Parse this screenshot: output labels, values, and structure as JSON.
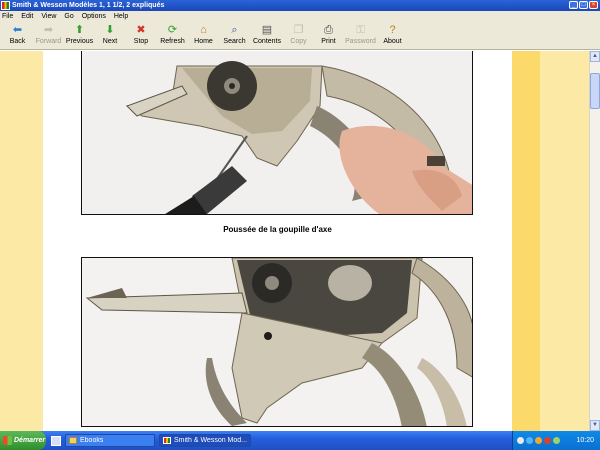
{
  "window": {
    "title": "Smith & Wesson Modèles 1, 1 1/2, 2 expliqués",
    "controls": [
      "_",
      "□",
      "×"
    ]
  },
  "menu": [
    "File",
    "Edit",
    "View",
    "Go",
    "Options",
    "Help"
  ],
  "toolbar": [
    {
      "label": "Back",
      "icon": "back-arrow-icon",
      "glyph": "⬅",
      "color": "#2a7fd4",
      "enabled": true
    },
    {
      "label": "Forward",
      "icon": "forward-arrow-icon",
      "glyph": "➡",
      "color": "#8a8a8a",
      "enabled": false
    },
    {
      "label": "Previous",
      "icon": "previous-arrow-icon",
      "glyph": "⬆",
      "color": "#2f9e2f",
      "enabled": true
    },
    {
      "label": "Next",
      "icon": "next-arrow-icon",
      "glyph": "⬇",
      "color": "#2f9e2f",
      "enabled": true
    },
    {
      "label": "Stop",
      "icon": "stop-icon",
      "glyph": "✖",
      "color": "#d3342a",
      "enabled": true
    },
    {
      "label": "Refresh",
      "icon": "refresh-icon",
      "glyph": "⟳",
      "color": "#2f9e2f",
      "enabled": true
    },
    {
      "label": "Home",
      "icon": "home-icon",
      "glyph": "⌂",
      "color": "#c77b1e",
      "enabled": true
    },
    {
      "label": "Search",
      "icon": "search-icon",
      "glyph": "⌕",
      "color": "#3b5ea8",
      "enabled": true
    },
    {
      "label": "Contents",
      "icon": "contents-icon",
      "glyph": "▤",
      "color": "#555555",
      "enabled": true
    },
    {
      "label": "Copy",
      "icon": "copy-icon",
      "glyph": "❐",
      "color": "#8a8a8a",
      "enabled": false
    },
    {
      "label": "Print",
      "icon": "print-icon",
      "glyph": "⎙",
      "color": "#444444",
      "enabled": true
    },
    {
      "label": "Password",
      "icon": "key-icon",
      "glyph": "⚿",
      "color": "#8a8a8a",
      "enabled": false
    },
    {
      "label": "About",
      "icon": "about-icon",
      "glyph": "?",
      "color": "#c77b1e",
      "enabled": true
    }
  ],
  "page": {
    "caption": "Poussée de la goupille d'axe"
  },
  "colors": {
    "page_bg": "#ffffff",
    "stripe_light": "#fde9a6",
    "stripe_dark": "#fcd96b",
    "background": "#fef6dd"
  },
  "taskbar": {
    "start_label": "Démarrer",
    "tasks": [
      {
        "label": "Ebooks",
        "icon": "folder-icon"
      },
      {
        "label": "Smith & Wesson Mod...",
        "icon": "ebook-icon"
      }
    ],
    "clock": "10:20"
  }
}
